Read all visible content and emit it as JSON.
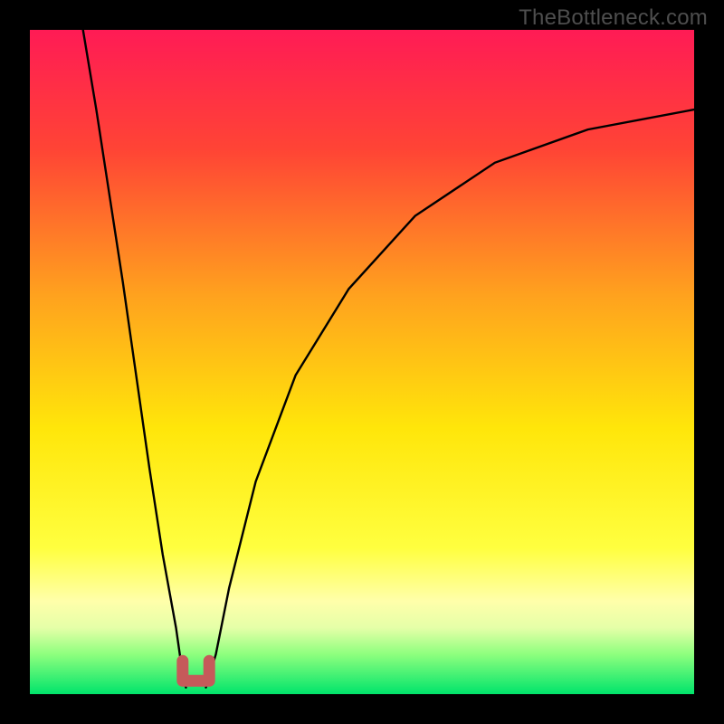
{
  "watermark": "TheBottleneck.com",
  "chart_data": {
    "type": "line",
    "title": "",
    "xlabel": "",
    "ylabel": "",
    "xlim": [
      0,
      100
    ],
    "ylim": [
      0,
      100
    ],
    "legend": false,
    "grid": false,
    "series": [
      {
        "name": "left-curve",
        "x": [
          8,
          10,
          12,
          14,
          16,
          18,
          20,
          22,
          23,
          23.5
        ],
        "y": [
          100,
          88,
          75,
          62,
          48,
          34,
          21,
          10,
          3,
          1
        ]
      },
      {
        "name": "right-curve",
        "x": [
          26.5,
          28,
          30,
          34,
          40,
          48,
          58,
          70,
          84,
          100
        ],
        "y": [
          1,
          6,
          16,
          32,
          48,
          61,
          72,
          80,
          85,
          88
        ]
      }
    ],
    "marker": {
      "name": "u-marker",
      "x_range": [
        23,
        27
      ],
      "y": 2,
      "color": "#c55a5a"
    },
    "gradient_stops": [
      {
        "pos": 0.0,
        "color": "#ff1b55"
      },
      {
        "pos": 0.18,
        "color": "#ff4435"
      },
      {
        "pos": 0.4,
        "color": "#ffa21e"
      },
      {
        "pos": 0.6,
        "color": "#ffe60a"
      },
      {
        "pos": 0.78,
        "color": "#ffff3f"
      },
      {
        "pos": 0.86,
        "color": "#ffffaa"
      },
      {
        "pos": 0.9,
        "color": "#e5ffa8"
      },
      {
        "pos": 0.94,
        "color": "#8eff7e"
      },
      {
        "pos": 1.0,
        "color": "#00e46b"
      }
    ]
  }
}
